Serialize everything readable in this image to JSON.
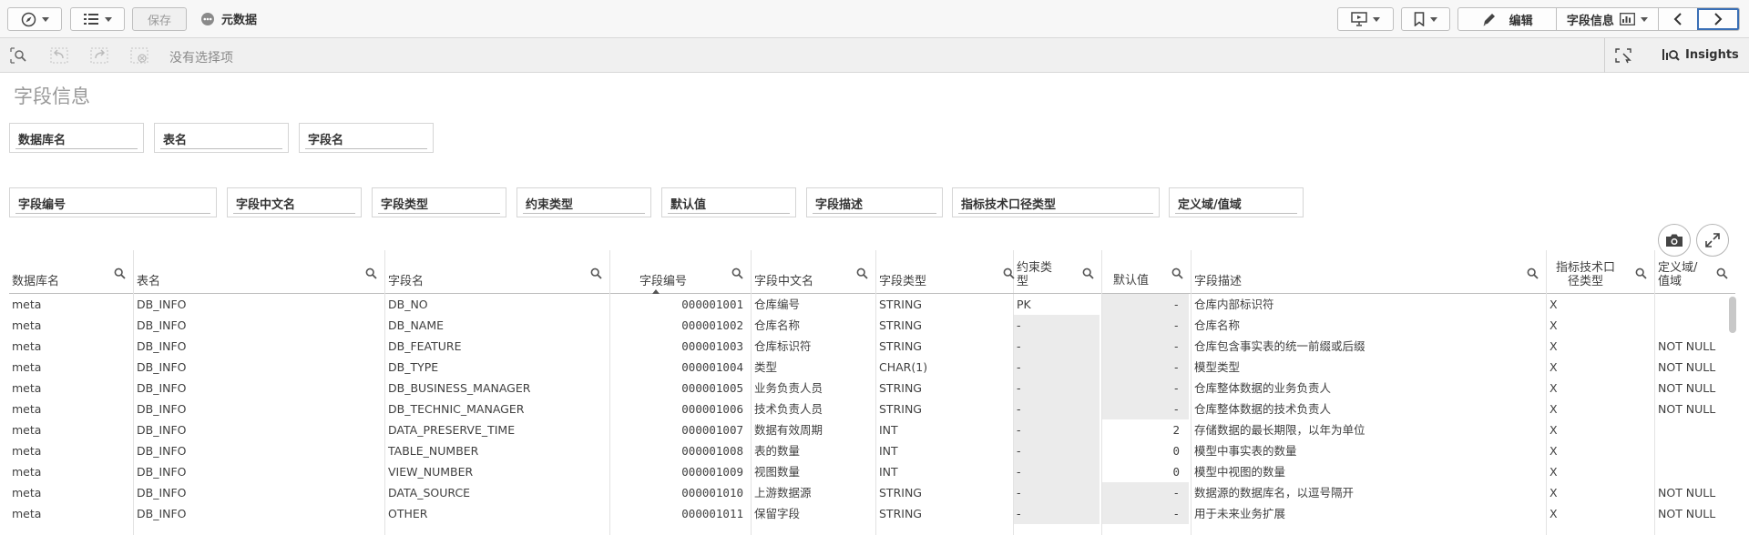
{
  "toolbar": {
    "save_label": "保存",
    "app_title": "元数据",
    "edit_label": "编辑",
    "sheet_menu_label": "字段信息"
  },
  "selection_bar": {
    "no_selection_text": "没有选择项",
    "insights_label": "Insights"
  },
  "sheet": {
    "title": "字段信息",
    "filters_row1": [
      "数据库名",
      "表名",
      "字段名"
    ],
    "filters_row2": [
      "字段编号",
      "字段中文名",
      "字段类型",
      "约束类型",
      "默认值",
      "字段描述",
      "指标技术口径类型",
      "定义域/值域"
    ]
  },
  "table": {
    "columns": [
      {
        "label": "数据库名"
      },
      {
        "label": "表名"
      },
      {
        "label": "字段名"
      },
      {
        "label": "字段编号"
      },
      {
        "label": "字段中文名"
      },
      {
        "label": "字段类型"
      },
      {
        "label": "约束类\n型"
      },
      {
        "label": "默认值"
      },
      {
        "label": "字段描述"
      },
      {
        "label": "指标技术口\n径类型"
      },
      {
        "label": "定义域/\n值域"
      }
    ],
    "rows": [
      [
        "meta",
        "DB_INFO",
        "DB_NO",
        "000001001",
        "仓库编号",
        "STRING",
        "PK",
        "-",
        "仓库内部标识符",
        "X",
        ""
      ],
      [
        "meta",
        "DB_INFO",
        "DB_NAME",
        "000001002",
        "仓库名称",
        "STRING",
        "-",
        "-",
        "仓库名称",
        "X",
        ""
      ],
      [
        "meta",
        "DB_INFO",
        "DB_FEATURE",
        "000001003",
        "仓库标识符",
        "STRING",
        "-",
        "-",
        "仓库包含事实表的统一前缀或后缀",
        "X",
        "NOT NULL"
      ],
      [
        "meta",
        "DB_INFO",
        "DB_TYPE",
        "000001004",
        "类型",
        "CHAR(1)",
        "-",
        "-",
        "模型类型",
        "X",
        "NOT NULL"
      ],
      [
        "meta",
        "DB_INFO",
        "DB_BUSINESS_MANAGER",
        "000001005",
        "业务负责人员",
        "STRING",
        "-",
        "-",
        "仓库整体数据的业务负责人",
        "X",
        "NOT NULL"
      ],
      [
        "meta",
        "DB_INFO",
        "DB_TECHNIC_MANAGER",
        "000001006",
        "技术负责人员",
        "STRING",
        "-",
        "-",
        "仓库整体数据的技术负责人",
        "X",
        "NOT NULL"
      ],
      [
        "meta",
        "DB_INFO",
        "DATA_PRESERVE_TIME",
        "000001007",
        "数据有效周期",
        "INT",
        "-",
        "2",
        "存储数据的最长期限，以年为单位",
        "X",
        ""
      ],
      [
        "meta",
        "DB_INFO",
        "TABLE_NUMBER",
        "000001008",
        "表的数量",
        "INT",
        "-",
        "0",
        "模型中事实表的数量",
        "X",
        ""
      ],
      [
        "meta",
        "DB_INFO",
        "VIEW_NUMBER",
        "000001009",
        "视图数量",
        "INT",
        "-",
        "0",
        "模型中视图的数量",
        "X",
        ""
      ],
      [
        "meta",
        "DB_INFO",
        "DATA_SOURCE",
        "000001010",
        "上游数据源",
        "STRING",
        "-",
        "-",
        "数据源的数据库名，以逗号隔开",
        "X",
        "NOT NULL"
      ],
      [
        "meta",
        "DB_INFO",
        "OTHER",
        "000001011",
        "保留字段",
        "STRING",
        "-",
        "-",
        "用于未来业务扩展",
        "X",
        "NOT NULL"
      ]
    ]
  }
}
